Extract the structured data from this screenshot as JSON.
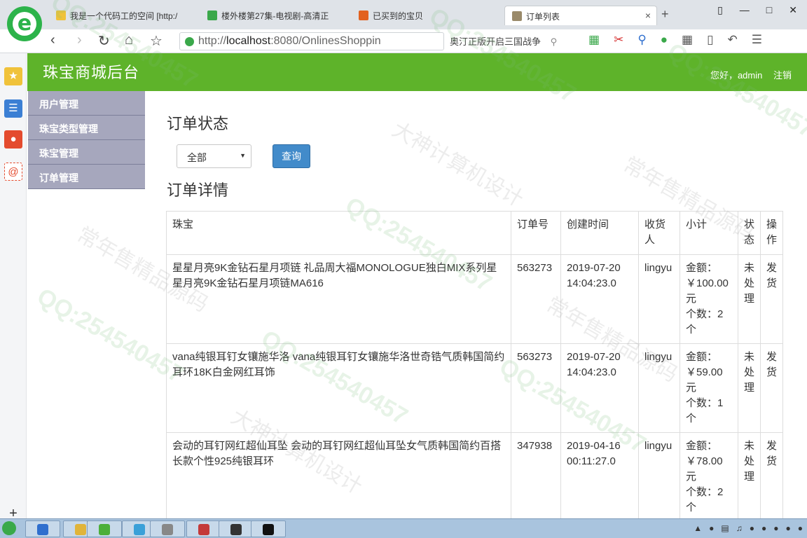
{
  "browser": {
    "tabs": [
      {
        "label": "我是一个代码工的空间 [http:/"
      },
      {
        "label": "楼外楼第27集-电视剧-高清正"
      },
      {
        "label": "已买到的宝贝"
      },
      {
        "label": "订单列表"
      }
    ],
    "url_prefix": "http://",
    "url_host": "localhost",
    "url_rest": ":8080/OnlinesShoppin",
    "search_text": "奥汀正版开启三国战争",
    "new_tab": "+",
    "close_tab": "×"
  },
  "app": {
    "title": "珠宝商城后台",
    "greeting": "您好，admin",
    "logout": "注销"
  },
  "menu": [
    {
      "label": "用户管理"
    },
    {
      "label": "珠宝类型管理"
    },
    {
      "label": "珠宝管理"
    },
    {
      "label": "订单管理"
    }
  ],
  "main": {
    "status_heading": "订单状态",
    "status_select": "全部",
    "query_button": "查询",
    "detail_heading": "订单详情"
  },
  "table": {
    "headers": [
      "珠宝",
      "订单号",
      "创建时间",
      "收货人",
      "小计",
      "状态",
      "操作"
    ],
    "rows": [
      {
        "product": "星星月亮9K金钻石星月项链  礼品周大福MONOLOGUE独白MIX系列星星月亮9K金钻石星月项链MA616",
        "order_no": "563273",
        "created": "2019-07-20 14:04:23.0",
        "receiver": "lingyu",
        "amount": "金额：￥100.00元",
        "count": "个数：2个",
        "status": "未处理",
        "action": "发货"
      },
      {
        "product": "vana纯银耳钉女镶施华洛  vana纯银耳钉女镶施华洛世奇锆气质韩国简约耳环18K白金网红耳饰",
        "order_no": "563273",
        "created": "2019-07-20 14:04:23.0",
        "receiver": "lingyu",
        "amount": "金额：￥59.00元",
        "count": "个数：1个",
        "status": "未处理",
        "action": "发货"
      },
      {
        "product": "会动的耳钉网红超仙耳坠  会动的耳钉网红超仙耳坠女气质韩国简约百搭长款个性925纯银耳环",
        "order_no": "347938",
        "created": "2019-04-16 00:11:27.0",
        "receiver": "lingyu",
        "amount": "金额：￥78.00元",
        "count": "个数：2个",
        "status": "未处理",
        "action": "发货"
      }
    ]
  },
  "watermarks": {
    "qq": "QQ:254540457",
    "brand": "常年售精品源码",
    "design": "大神计算机设计"
  },
  "colors": {
    "header_green": "#5eb32a",
    "menu_bg": "#a6a7bd",
    "button_blue": "#428bca"
  }
}
